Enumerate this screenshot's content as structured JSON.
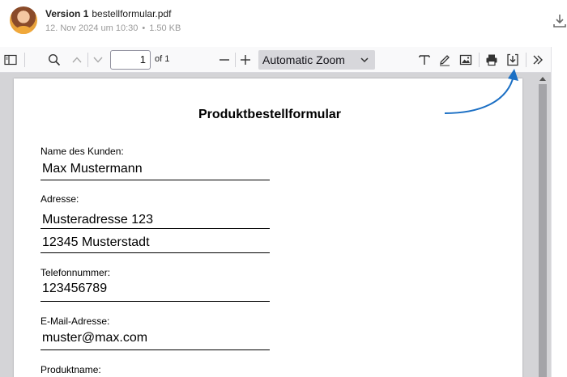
{
  "header": {
    "version_label": "Version 1",
    "filename": "bestellformular.pdf",
    "date": "12. Nov 2024 um 10:30",
    "separator": "•",
    "size": "1.50 KB"
  },
  "toolbar": {
    "page_value": "1",
    "page_of": "of 1",
    "zoom_value": "Automatic Zoom",
    "icons": [
      "sidebar-toggle-icon",
      "search-icon",
      "chevron-up-icon",
      "chevron-down-icon",
      "zoom-out-icon",
      "zoom-in-icon",
      "text-icon",
      "draw-icon",
      "image-icon",
      "print-icon",
      "save-icon",
      "double-chevron-icon"
    ]
  },
  "document": {
    "title": "Produktbestellformular",
    "fields": [
      {
        "label": "Name des Kunden:",
        "values": [
          "Max Mustermann"
        ]
      },
      {
        "label": "Adresse:",
        "values": [
          "Musteradresse 123",
          "12345 Musterstadt"
        ]
      },
      {
        "label": "Telefonnummer:",
        "values": [
          "123456789"
        ]
      },
      {
        "label": "E-Mail-Adresse:",
        "values": [
          "muster@max.com"
        ]
      },
      {
        "label": "Produktname:",
        "values": []
      }
    ]
  },
  "colors": {
    "annotation_arrow": "#1b6fc4",
    "zoom_bg": "#d7d7db",
    "viewer_bg": "#d4d4d7"
  }
}
